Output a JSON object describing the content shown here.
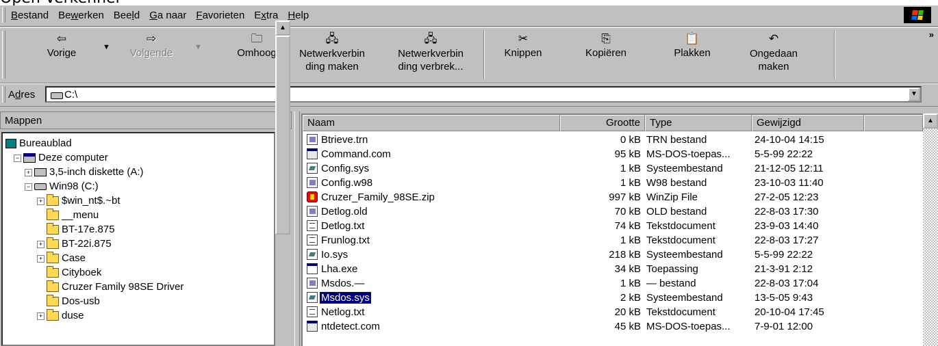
{
  "window": {
    "title_fragment": "Open Verkenner"
  },
  "menubar": {
    "items": [
      {
        "pre": "",
        "u": "B",
        "post": "estand"
      },
      {
        "pre": "Be",
        "u": "w",
        "post": "erken"
      },
      {
        "pre": "Bee",
        "u": "l",
        "post": "d"
      },
      {
        "pre": "",
        "u": "G",
        "post": "a naar"
      },
      {
        "pre": "",
        "u": "F",
        "post": "avorieten"
      },
      {
        "pre": "E",
        "u": "x",
        "post": "tra"
      },
      {
        "pre": "",
        "u": "H",
        "post": "elp"
      }
    ]
  },
  "toolbar": {
    "back_label": "Vorige",
    "forward_label": "Volgende",
    "up_label": "Omhoog",
    "map_drive_label": "Netwerkverbin ding maken",
    "disconnect_label": "Netwerkverbin ding verbrek...",
    "cut_label": "Knippen",
    "copy_label": "Kopiëren",
    "paste_label": "Plakken",
    "undo_label": "Ongedaan maken",
    "more": "»"
  },
  "address": {
    "label_pre": "A",
    "label_u": "d",
    "label_post": "res",
    "value": "C:\\"
  },
  "folders_pane": {
    "title": "Mappen",
    "close": "×",
    "tree": [
      {
        "label": "Bureaublad",
        "level": 0,
        "icon": "desktop"
      },
      {
        "label": "Deze computer",
        "level": 1,
        "icon": "computer",
        "expander": "-"
      },
      {
        "label": "3,5-inch diskette (A:)",
        "level": 2,
        "icon": "floppy",
        "expander": "+"
      },
      {
        "label": "Win98 (C:)",
        "level": 2,
        "icon": "harddisk",
        "expander": "-"
      },
      {
        "label": "$win_nt$.~bt",
        "level": 3,
        "icon": "folder",
        "expander": "+"
      },
      {
        "label": "__menu",
        "level": 3,
        "icon": "folder"
      },
      {
        "label": "BT-17e.875",
        "level": 3,
        "icon": "folder"
      },
      {
        "label": "BT-22i.875",
        "level": 3,
        "icon": "folder",
        "expander": "+"
      },
      {
        "label": "Case",
        "level": 3,
        "icon": "folder",
        "expander": "+"
      },
      {
        "label": "Cityboek",
        "level": 3,
        "icon": "folder"
      },
      {
        "label": "Cruzer Family 98SE Driver",
        "level": 3,
        "icon": "folder"
      },
      {
        "label": "Dos-usb",
        "level": 3,
        "icon": "folder"
      },
      {
        "label": "duse",
        "level": 3,
        "icon": "folder",
        "expander": "+"
      }
    ]
  },
  "file_list": {
    "columns": [
      "Naam",
      "Grootte",
      "Type",
      "Gewijzigd"
    ],
    "rows": [
      {
        "name": "Btrieve.trn",
        "size": "0 kB",
        "type": "TRN bestand",
        "modified": "24-10-04 14:15",
        "icon": "gen"
      },
      {
        "name": "Command.com",
        "size": "95 kB",
        "type": "MS-DOS-toepas...",
        "modified": "5-5-99 22:22",
        "icon": "dos"
      },
      {
        "name": "Config.sys",
        "size": "1 kB",
        "type": "Systeembestand",
        "modified": "21-12-05 12:11",
        "icon": "sys"
      },
      {
        "name": "Config.w98",
        "size": "1 kB",
        "type": "W98 bestand",
        "modified": "23-10-03 11:40",
        "icon": "gen"
      },
      {
        "name": "Cruzer_Family_98SE.zip",
        "size": "997 kB",
        "type": "WinZip File",
        "modified": "27-2-05 12:23",
        "icon": "zip"
      },
      {
        "name": "Detlog.old",
        "size": "70 kB",
        "type": "OLD bestand",
        "modified": "22-8-03 17:30",
        "icon": "gen"
      },
      {
        "name": "Detlog.txt",
        "size": "74 kB",
        "type": "Tekstdocument",
        "modified": "23-9-03 14:40",
        "icon": "doc"
      },
      {
        "name": "Frunlog.txt",
        "size": "1 kB",
        "type": "Tekstdocument",
        "modified": "22-8-03 17:27",
        "icon": "doc"
      },
      {
        "name": "Io.sys",
        "size": "218 kB",
        "type": "Systeembestand",
        "modified": "5-5-99 22:22",
        "icon": "sys"
      },
      {
        "name": "Lha.exe",
        "size": "34 kB",
        "type": "Toepassing",
        "modified": "21-3-91 2:12",
        "icon": "app"
      },
      {
        "name": "Msdos.—",
        "size": "1 kB",
        "type": "— bestand",
        "modified": "22-8-03 17:04",
        "icon": "gen"
      },
      {
        "name": "Msdos.sys",
        "size": "2 kB",
        "type": "Systeembestand",
        "modified": "13-5-05 9:43",
        "icon": "sys",
        "selected": true
      },
      {
        "name": "Netlog.txt",
        "size": "20 kB",
        "type": "Tekstdocument",
        "modified": "20-10-04 17:45",
        "icon": "doc"
      },
      {
        "name": "ntdetect.com",
        "size": "45 kB",
        "type": "MS-DOS-toepas...",
        "modified": "7-9-01 12:00",
        "icon": "dos"
      }
    ]
  },
  "colors": {
    "selection": "#000080",
    "face": "#c0c0c0"
  }
}
